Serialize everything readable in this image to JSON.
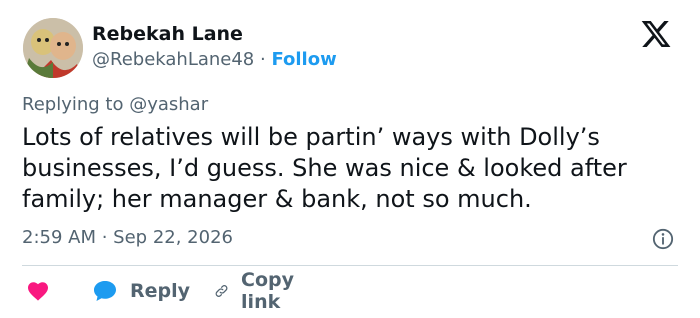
{
  "tweet": {
    "author_name": "Rebekah Lane",
    "handle": "@RebekahLane48",
    "separator": " · ",
    "follow_label": "Follow",
    "reply_prefix": "Replying to ",
    "reply_mention": "@yashar",
    "text": "Lots of relatives will be partin’ ways with Dolly’s businesses, I’d guess. She was nice & looked after family; her manager & bank, not so much.",
    "time": "2:59 AM",
    "date_separator": " · ",
    "date": "Sep 22, 2026"
  },
  "actions": {
    "reply_label": "Reply",
    "copy_label": "Copy link"
  },
  "icons": {
    "logo": "x-logo-icon",
    "info": "info-icon",
    "heart": "heart-icon",
    "reply": "speech-bubble-icon",
    "copy": "link-icon"
  },
  "colors": {
    "accent": "#1d9bf0",
    "heart": "#f91880",
    "secondary_text": "#536471",
    "primary_text": "#0f1419"
  }
}
